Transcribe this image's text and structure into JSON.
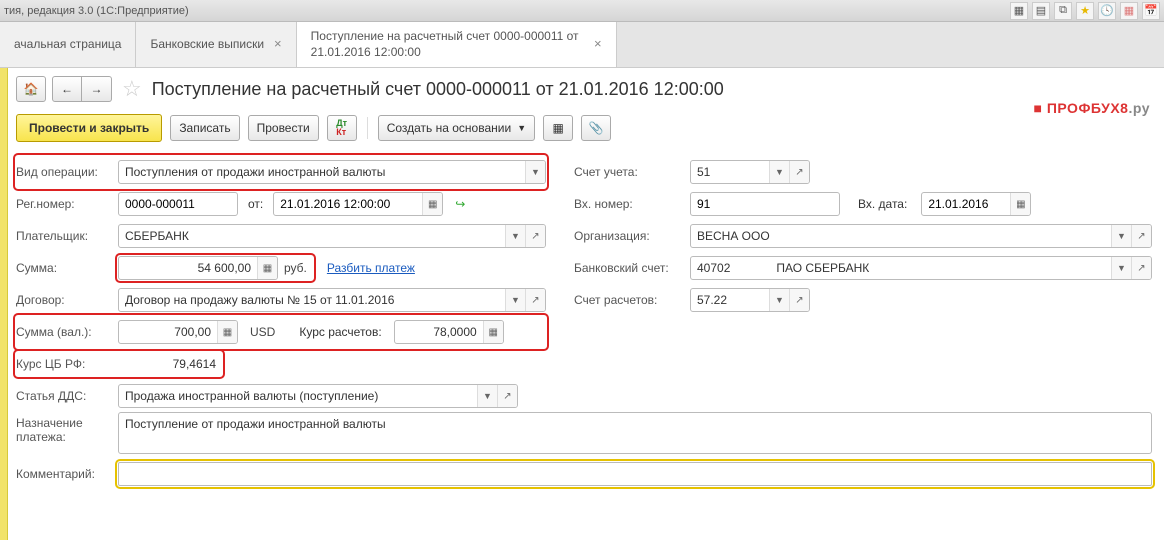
{
  "titlebar": {
    "text": "тия, редакция 3.0  (1С:Предприятие)"
  },
  "tabs": [
    {
      "label": "ачальная страница",
      "closable": false,
      "active": false
    },
    {
      "label": "Банковские выписки",
      "closable": true,
      "active": false
    },
    {
      "label": "Поступление на расчетный счет 0000-000011 от 21.01.2016 12:00:00",
      "closable": true,
      "active": true
    }
  ],
  "header": {
    "title": "Поступление на расчетный счет 0000-000011 от 21.01.2016 12:00:00"
  },
  "brand": {
    "left": "ПРОФБУХ8",
    "right": ".ру"
  },
  "toolbar": {
    "post_close": "Провести и закрыть",
    "save": "Записать",
    "post": "Провести",
    "create_based": "Создать на основании"
  },
  "labels": {
    "op_type": "Вид операции:",
    "reg_num": "Рег.номер:",
    "from": "от:",
    "payer": "Плательщик:",
    "amount": "Сумма:",
    "rub": "руб.",
    "split_payment": "Разбить платеж",
    "contract": "Договор:",
    "amount_cur": "Сумма (вал.):",
    "usd": "USD",
    "rate_calc": "Курс расчетов:",
    "cb_rate": "Курс ЦБ РФ:",
    "dds": "Статья ДДС:",
    "purpose": "Назначение платежа:",
    "comment": "Комментарий:",
    "account": "Счет учета:",
    "in_num": "Вх. номер:",
    "in_date": "Вх. дата:",
    "org": "Организация:",
    "bank_acc": "Банковский счет:",
    "settle_acc": "Счет расчетов:"
  },
  "values": {
    "op_type": "Поступления от продажи иностранной валюты",
    "reg_num": "0000-000011",
    "datetime": "21.01.2016 12:00:00",
    "payer": "СБЕРБАНК",
    "amount": "54 600,00",
    "contract": "Договор на продажу валюты № 15 от 11.01.2016",
    "amount_cur": "700,00",
    "rate_calc": "78,0000",
    "cb_rate": "79,4614",
    "dds": "Продажа иностранной валюты (поступление)",
    "purpose": "Поступление от продажи иностранной валюты",
    "comment": "",
    "account": "51",
    "in_num": "91",
    "in_date": "21.01.2016",
    "org": "ВЕСНА ООО",
    "bank_acc_l": "40702",
    "bank_acc_r": "ПАО СБЕРБАНК",
    "settle_acc": "57.22"
  }
}
